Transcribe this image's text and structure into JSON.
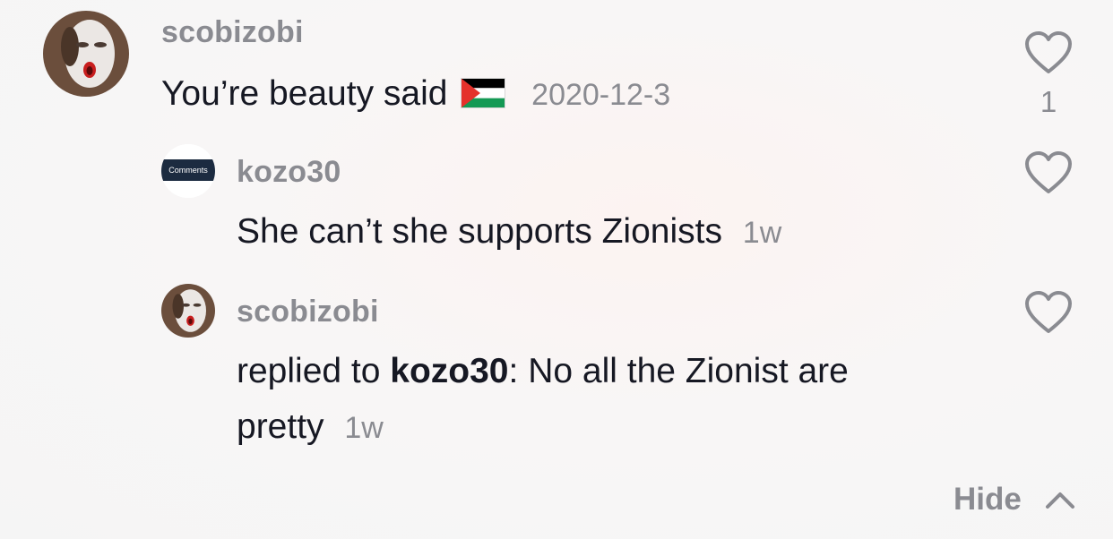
{
  "comments": [
    {
      "username": "scobizobi",
      "text": "You’re beauty said",
      "flag_emoji": "🇵🇸",
      "timestamp": "2020-12-3",
      "like_count": "1"
    },
    {
      "username": "kozo30",
      "avatar_label": "Comments",
      "text": "She can’t she supports Zionists",
      "timestamp": "1w"
    },
    {
      "username": "scobizobi",
      "replied_prefix": "replied to",
      "reply_to": "kozo30",
      "separator": ":",
      "text_line1": "No all the Zionist are",
      "text_line2": "pretty",
      "timestamp": "1w"
    }
  ],
  "footer": {
    "hide_label": "Hide"
  },
  "colors": {
    "primary_text": "#161823",
    "secondary_text": "#8a8b91",
    "flag_black": "#000000",
    "flag_green": "#149954",
    "flag_red": "#e4312b"
  },
  "icons": {
    "like": "heart-outline-icon",
    "collapse": "chevron-up-icon"
  }
}
